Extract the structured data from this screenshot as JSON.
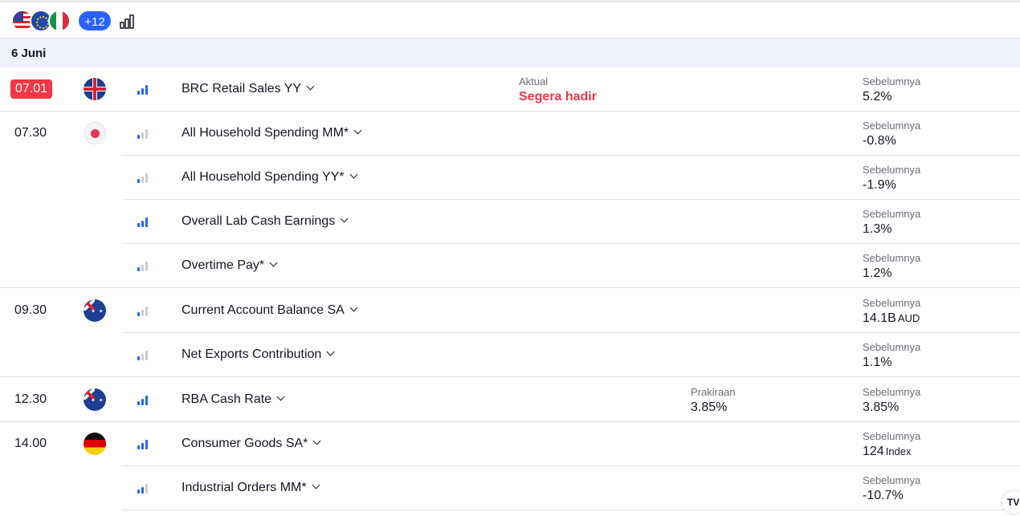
{
  "toolbar": {
    "flags": [
      "us-flag-icon",
      "eu-flag-icon",
      "it-flag-icon"
    ],
    "more_countries": "+12",
    "chart_icon": "bar-chart-icon"
  },
  "date_header": "6 Juni",
  "labels": {
    "actual": "Aktual",
    "forecast": "Prakiraan",
    "previous": "Sebelumnya",
    "coming_soon": "Segera hadir"
  },
  "events": [
    {
      "time": "07.01",
      "country": "gb-flag-icon",
      "importance": 3,
      "name": "BRC Retail Sales YY",
      "actual": "Segera hadir",
      "previous": "5.2%"
    },
    {
      "time": "07.30",
      "country": "jp-flag-icon",
      "importance": 1,
      "name": "All Household Spending MM*",
      "previous": "-0.8%"
    },
    {
      "time": "",
      "country": "",
      "importance": 1,
      "name": "All Household Spending YY*",
      "previous": "-1.9%"
    },
    {
      "time": "",
      "country": "",
      "importance": 3,
      "name": "Overall Lab Cash Earnings",
      "previous": "1.3%"
    },
    {
      "time": "",
      "country": "",
      "importance": 1,
      "name": "Overtime Pay*",
      "previous": "1.2%"
    },
    {
      "time": "09.30",
      "country": "au-flag-icon",
      "importance": 1,
      "name": "Current Account Balance SA",
      "previous": "14.1B",
      "previous_unit": "AUD"
    },
    {
      "time": "",
      "country": "",
      "importance": 1,
      "name": "Net Exports Contribution",
      "previous": "1.1%"
    },
    {
      "time": "12.30",
      "country": "au-flag-icon",
      "importance": 3,
      "name": "RBA Cash Rate",
      "forecast": "3.85%",
      "previous": "3.85%"
    },
    {
      "time": "14.00",
      "country": "de-flag-icon",
      "importance": 3,
      "name": "Consumer Goods SA*",
      "previous": "124",
      "previous_unit": "Index"
    },
    {
      "time": "",
      "country": "",
      "importance": 2,
      "name": "Industrial Orders MM*",
      "previous": "-10.7%"
    }
  ],
  "watermark": "TV"
}
